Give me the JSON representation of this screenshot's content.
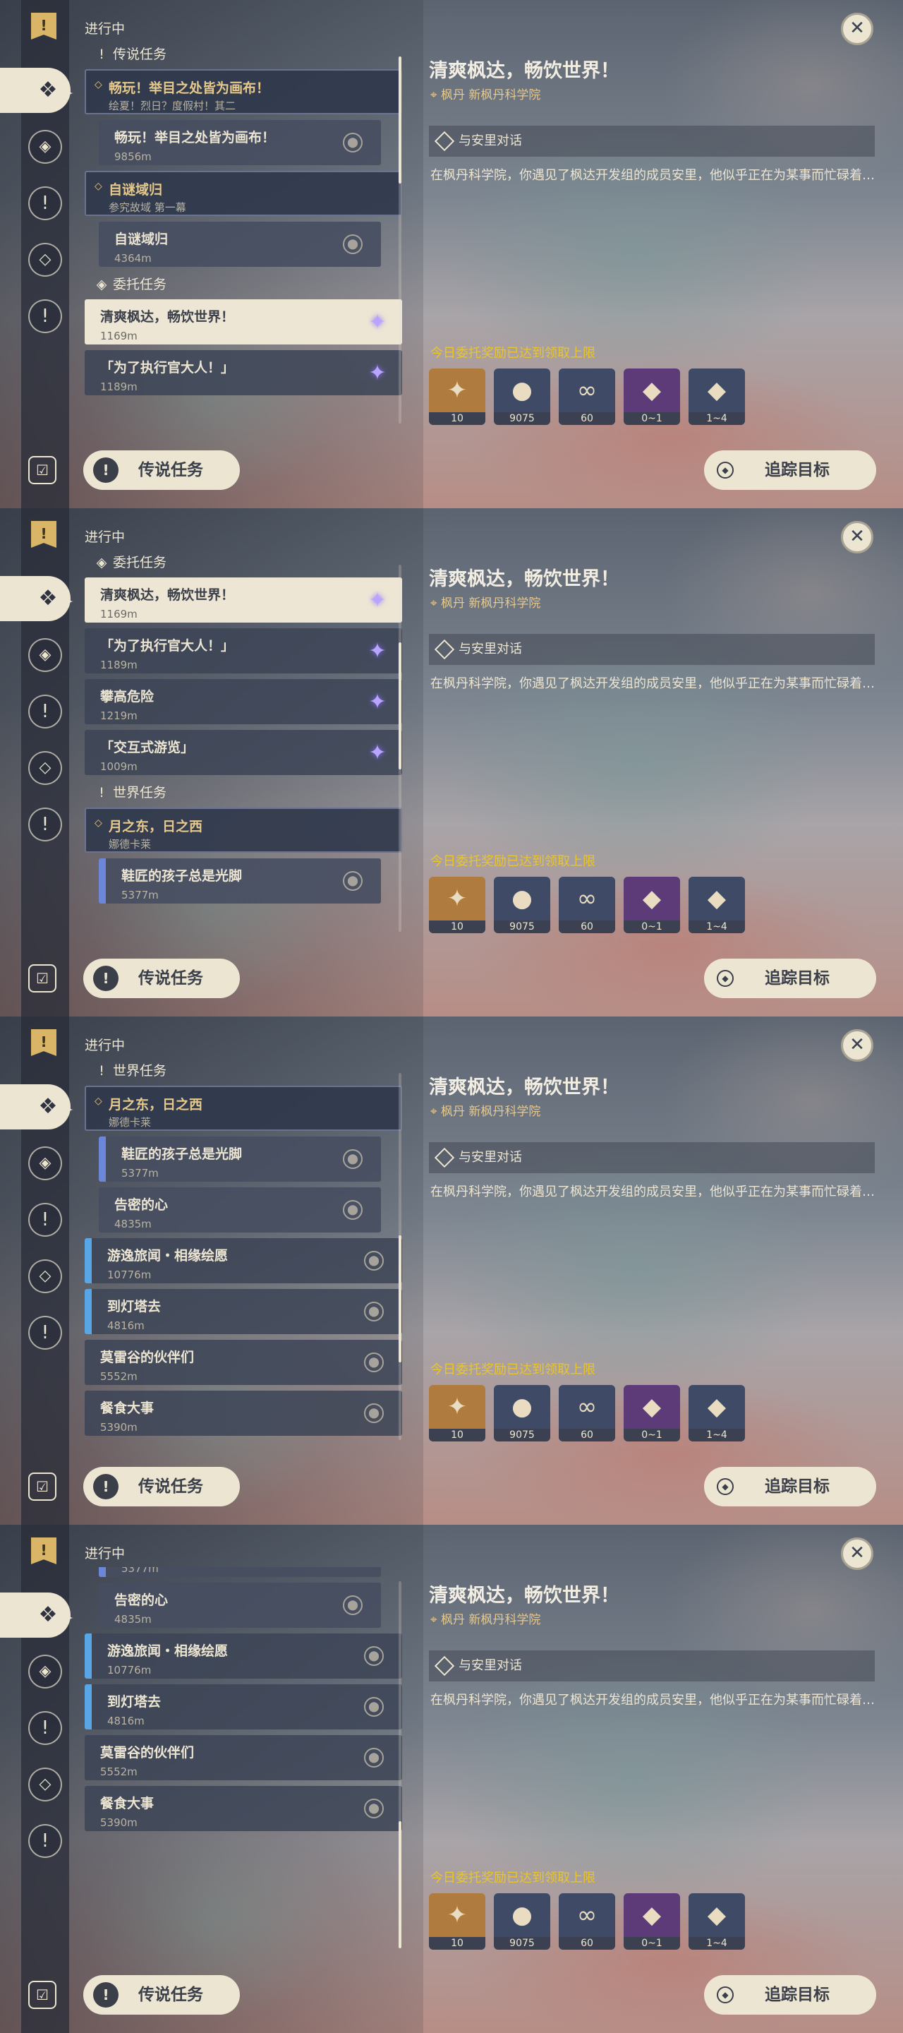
{
  "common": {
    "in_progress": "进行中",
    "legend_button": "传说任务",
    "track_button": "追踪目标",
    "close": "✕",
    "title": "清爽枫达，畅饮世界！",
    "location": "枫丹  新枫丹科学院",
    "objective": "与安里对话",
    "description": "在枫丹科学院，你遇见了枫达开发组的成员安里，他似乎正在为某事而忙碌着…",
    "reward_warning": "今日委托奖励已达到领取上限",
    "rewards": [
      {
        "name": "primogem-icon",
        "count": "10",
        "color": "#b07b3e",
        "glyph": "✦"
      },
      {
        "name": "mora-icon",
        "count": "9075",
        "color": "#3e4a66",
        "glyph": "●"
      },
      {
        "name": "friendship-icon",
        "count": "60",
        "color": "#3e4a66",
        "glyph": "∞"
      },
      {
        "name": "crystal-icon",
        "count": "0~1",
        "color": "#5d3b78",
        "glyph": "◆"
      },
      {
        "name": "ore-icon",
        "count": "1~4",
        "color": "#3e4a66",
        "glyph": "◆"
      }
    ]
  },
  "sections": {
    "legend": "传说任务",
    "commission": "委托任务",
    "world": "世界任务"
  },
  "quests": {
    "q1": {
      "title": "畅玩！举目之处皆为画布！",
      "sub": "绘夏！烈日？度假村！其二"
    },
    "q1a": {
      "title": "畅玩！举目之处皆为画布！",
      "dist": "9856m"
    },
    "q2": {
      "title": "自谜域归",
      "sub": "参究故域 第一幕"
    },
    "q2a": {
      "title": "自谜域归",
      "dist": "4364m"
    },
    "c1": {
      "title": "清爽枫达，畅饮世界！",
      "dist": "1169m"
    },
    "c2": {
      "title": "「为了执行官大人！」",
      "dist": "1189m"
    },
    "c3": {
      "title": "攀高危险",
      "dist": "1219m"
    },
    "c4": {
      "title": "「交互式游览」",
      "dist": "1009m"
    },
    "w1": {
      "title": "月之东，日之西",
      "sub": "娜德卡莱"
    },
    "w1a": {
      "title": "鞋匠的孩子总是光脚",
      "dist": "5377m"
    },
    "w1b": {
      "title": "告密的心",
      "dist": "4835m"
    },
    "w2": {
      "title": "游逸旅闻・相缘绘愿",
      "dist": "10776m"
    },
    "w3": {
      "title": "到灯塔去",
      "dist": "4816m"
    },
    "w4": {
      "title": "莫雷谷的伙伴们",
      "dist": "5552m"
    },
    "w5": {
      "title": "餐食大事",
      "dist": "5390m"
    }
  }
}
